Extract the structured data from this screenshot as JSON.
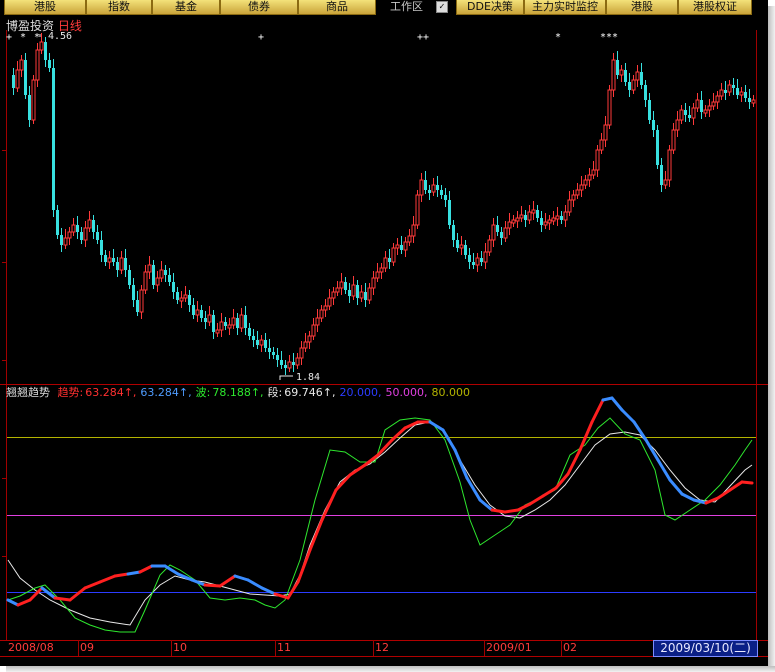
{
  "toolbar": {
    "buttons": [
      "港股",
      "指数",
      "基金",
      "债券",
      "商品"
    ],
    "work_label": "工作区",
    "right_buttons": [
      "DDE决策",
      "主力实时监控",
      "港股",
      "港股权证"
    ]
  },
  "chart_title": {
    "name": "博盈投资",
    "period": "日线"
  },
  "price_high": "4.56",
  "price_low": "1.84",
  "indicator": {
    "name": "翘翘趋势",
    "items": [
      {
        "label": "趋势:",
        "value": "63.284",
        "arrow": "↑",
        "color": "#ff3030"
      },
      {
        "label": "",
        "value": "63.284",
        "arrow": "↑",
        "color": "#4f9cff"
      },
      {
        "label": "波:",
        "value": "78.188",
        "arrow": "↑",
        "color": "#2ee82e"
      },
      {
        "label": "段:",
        "value": "69.746",
        "arrow": "↑",
        "color": "#e8e8e8"
      },
      {
        "label": "",
        "value": "20.000",
        "arrow": "",
        "color": "#2c3cff"
      },
      {
        "label": "",
        "value": "50.000",
        "arrow": "",
        "color": "#e040e0"
      },
      {
        "label": "",
        "value": "80.000",
        "arrow": "",
        "color": "#b4b400"
      }
    ]
  },
  "dates": [
    "2008/08",
    "09",
    "10",
    "11",
    "12",
    "2009/01",
    "02"
  ],
  "current_date": "2009/03/10(二)",
  "colors": {
    "up": "#ff3a3a",
    "down": "#38e0e0",
    "trend": "#ff2020",
    "trend_down": "#3a8cff",
    "wave": "#2ee82e",
    "segment": "#e8e8e8"
  },
  "chart_data": {
    "type": "candlestick",
    "price_range": [
      1.84,
      4.56
    ],
    "indicator_levels": [
      20,
      50,
      80
    ]
  }
}
